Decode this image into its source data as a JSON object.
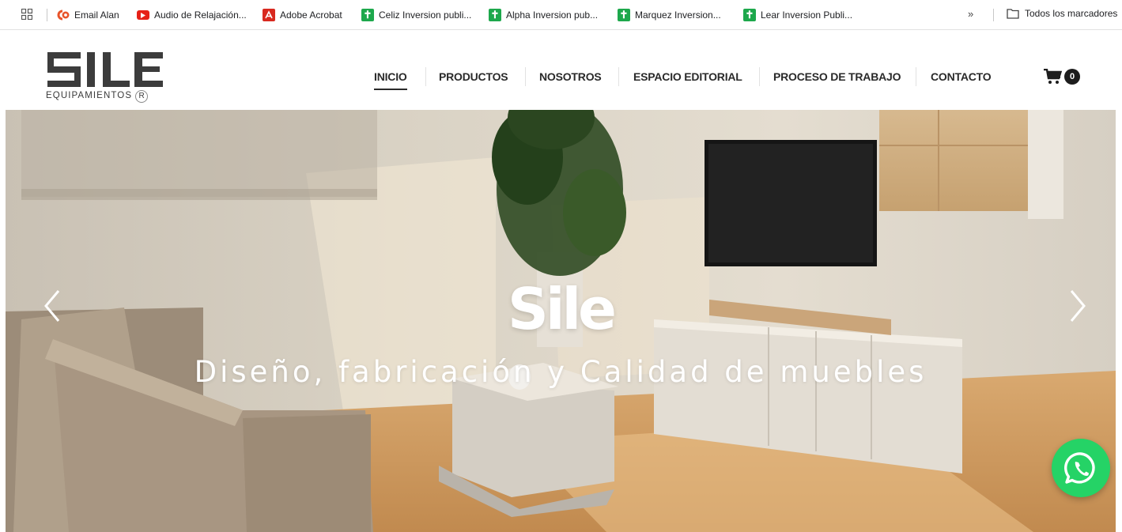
{
  "bookmarks_bar": {
    "items": [
      {
        "label": "Email Alan",
        "icon": "cp-icon"
      },
      {
        "label": "Audio de Relajación...",
        "icon": "youtube-icon"
      },
      {
        "label": "Adobe Acrobat",
        "icon": "acrobat-icon"
      },
      {
        "label": "Celiz Inversion publi...",
        "icon": "cross-icon"
      },
      {
        "label": "Alpha Inversion pub...",
        "icon": "cross-icon"
      },
      {
        "label": "Marquez Inversion...",
        "icon": "cross-icon"
      },
      {
        "label": "Lear Inversion Publi...",
        "icon": "cross-icon"
      }
    ],
    "more": "»",
    "all_bookmarks": "Todos los marcadores"
  },
  "header": {
    "logo_text": "SILE",
    "logo_tagline": "EQUIPAMIENTOS",
    "logo_registered": "R",
    "nav": [
      {
        "label": "INICIO",
        "active": true
      },
      {
        "label": "PRODUCTOS"
      },
      {
        "label": "NOSOTROS"
      },
      {
        "label": "ESPACIO EDITORIAL"
      },
      {
        "label": "PROCESO DE TRABAJO"
      },
      {
        "label": "CONTACTO"
      }
    ],
    "cart_count": "0"
  },
  "hero": {
    "title": "Sile",
    "subtitle": "Diseño, fabricación y Calidad de muebles"
  },
  "colors": {
    "whatsapp": "#25d366",
    "accent_text": "#2a2a2a",
    "logo": "#3c3c3c"
  }
}
